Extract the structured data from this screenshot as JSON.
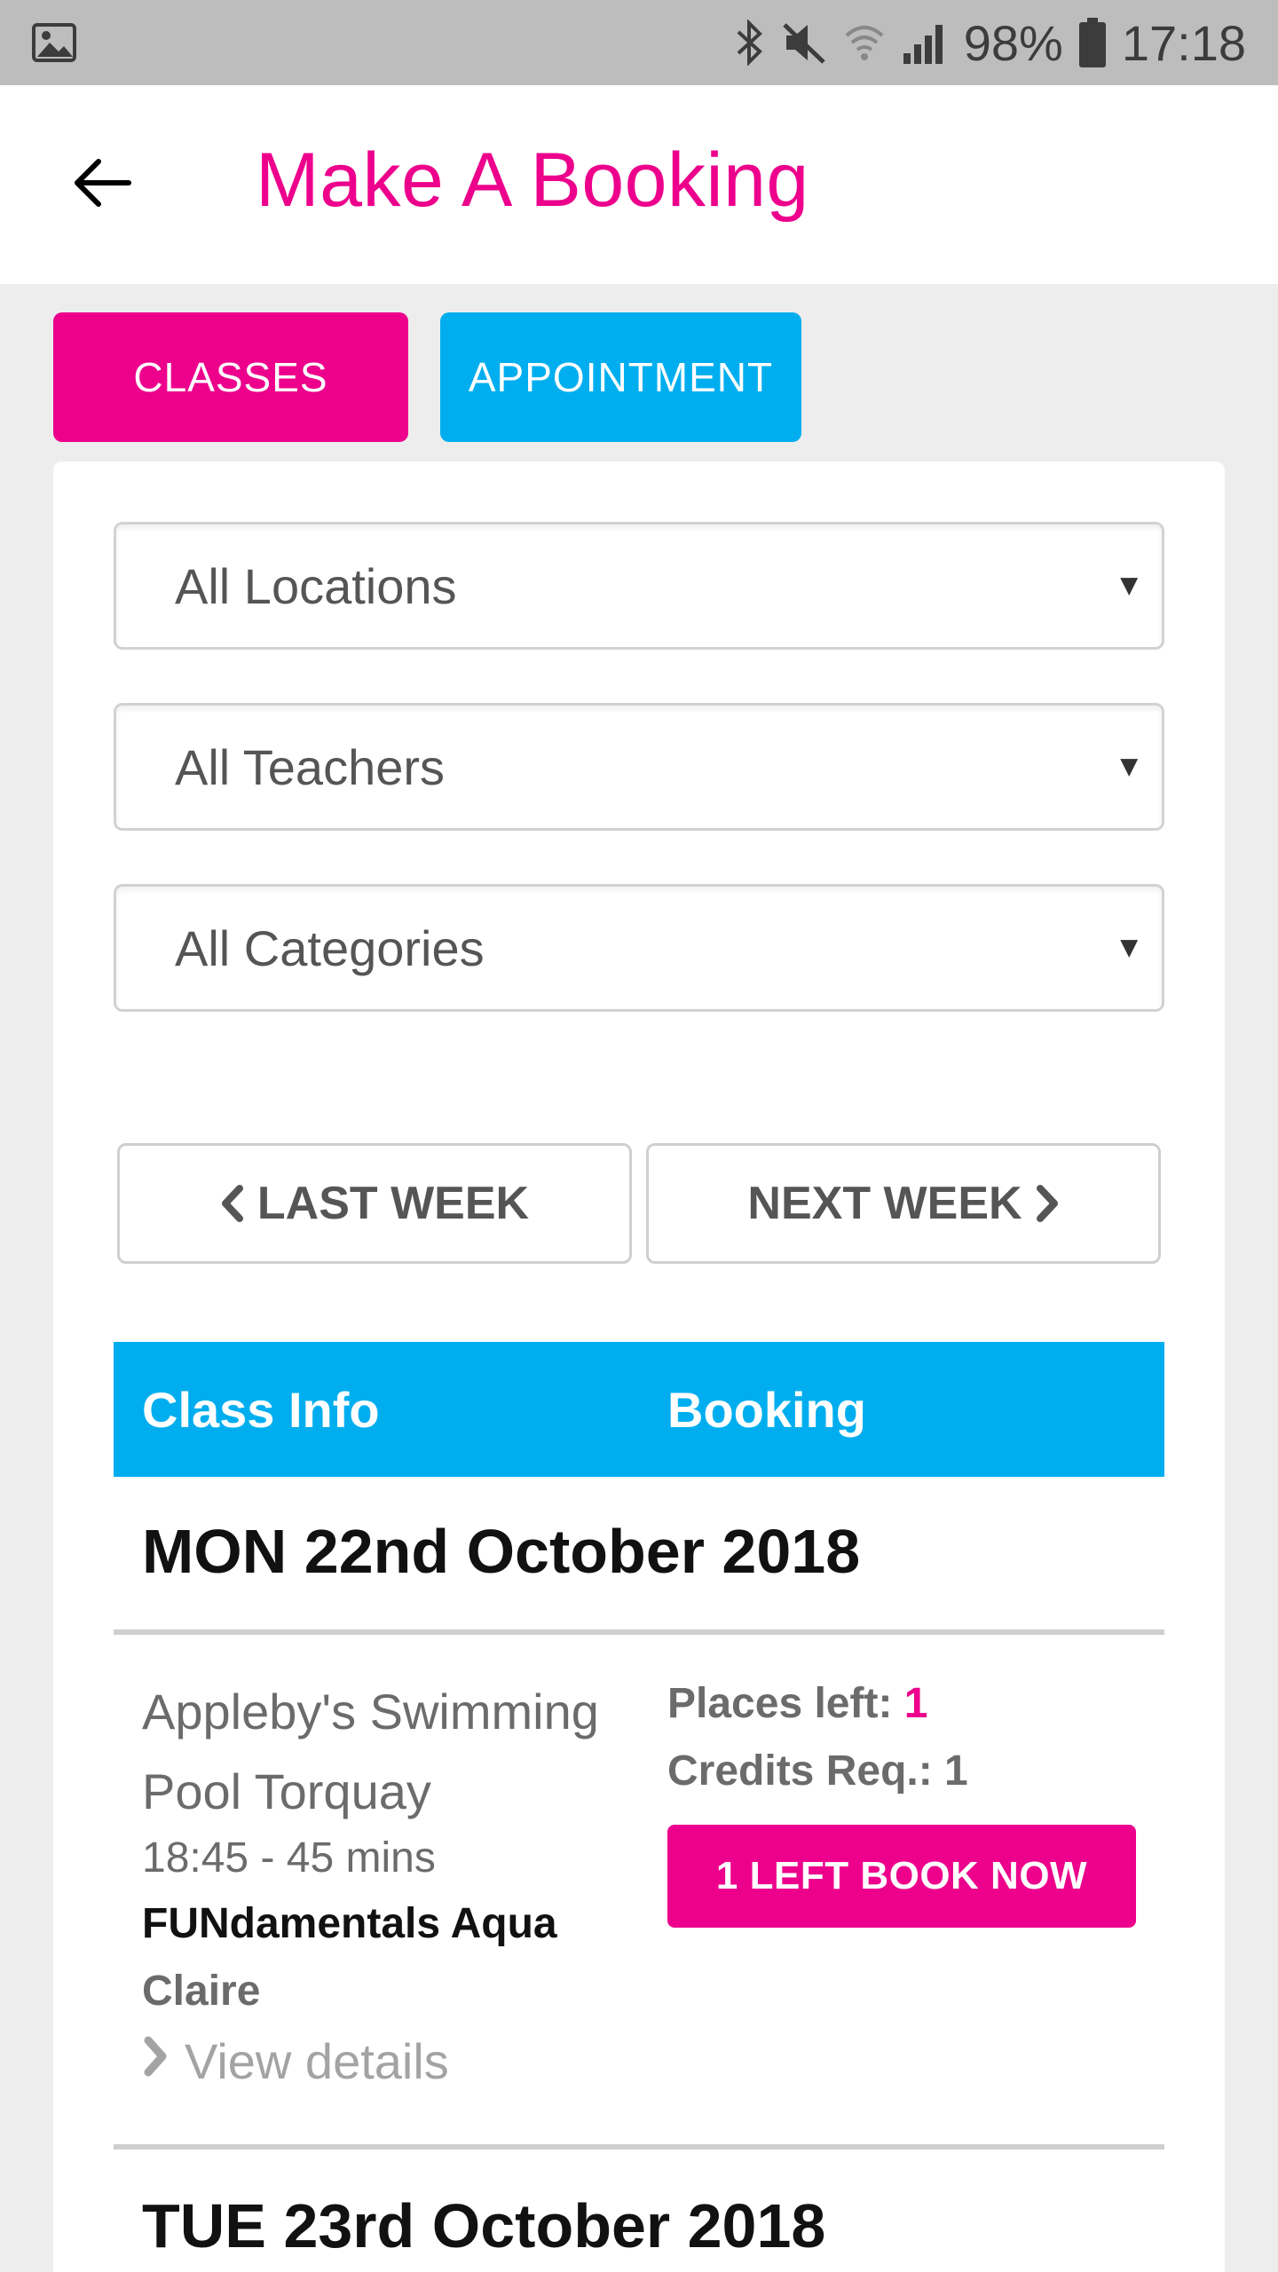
{
  "status_bar": {
    "battery": "98%",
    "time": "17:18",
    "icons": [
      "gallery-icon",
      "bluetooth-icon",
      "mute-icon",
      "wifi-icon",
      "signal-icon",
      "battery-icon"
    ]
  },
  "header": {
    "title": "Make A Booking",
    "back_icon": "arrow-left-icon"
  },
  "tabs": [
    {
      "label": "CLASSES",
      "active": true
    },
    {
      "label": "APPOINTMENT",
      "active": false
    }
  ],
  "filters": {
    "location": "All Locations",
    "teacher": "All Teachers",
    "category": "All Categories"
  },
  "nav": {
    "last_week": "LAST WEEK",
    "next_week": "NEXT WEEK"
  },
  "table": {
    "headers": [
      "Class Info",
      "Booking"
    ]
  },
  "days": [
    {
      "date": "MON 22nd October 2018",
      "classes": [
        {
          "location": "Appleby's Swimming Pool Torquay",
          "time": "18:45 - 45 mins",
          "name": "FUNdamentals Aqua",
          "teacher": "Claire",
          "details_label": "View details",
          "places_label": "Places left:",
          "places_value": "1",
          "credits_label": "Credits Req.: 1",
          "book_label": "1 LEFT BOOK NOW"
        }
      ]
    },
    {
      "date": "TUE 23rd October 2018",
      "classes": []
    }
  ],
  "colors": {
    "brand_pink": "#ec008c",
    "brand_blue": "#00aeef",
    "status_bar": "#bdbdbd",
    "background": "#ededed"
  }
}
